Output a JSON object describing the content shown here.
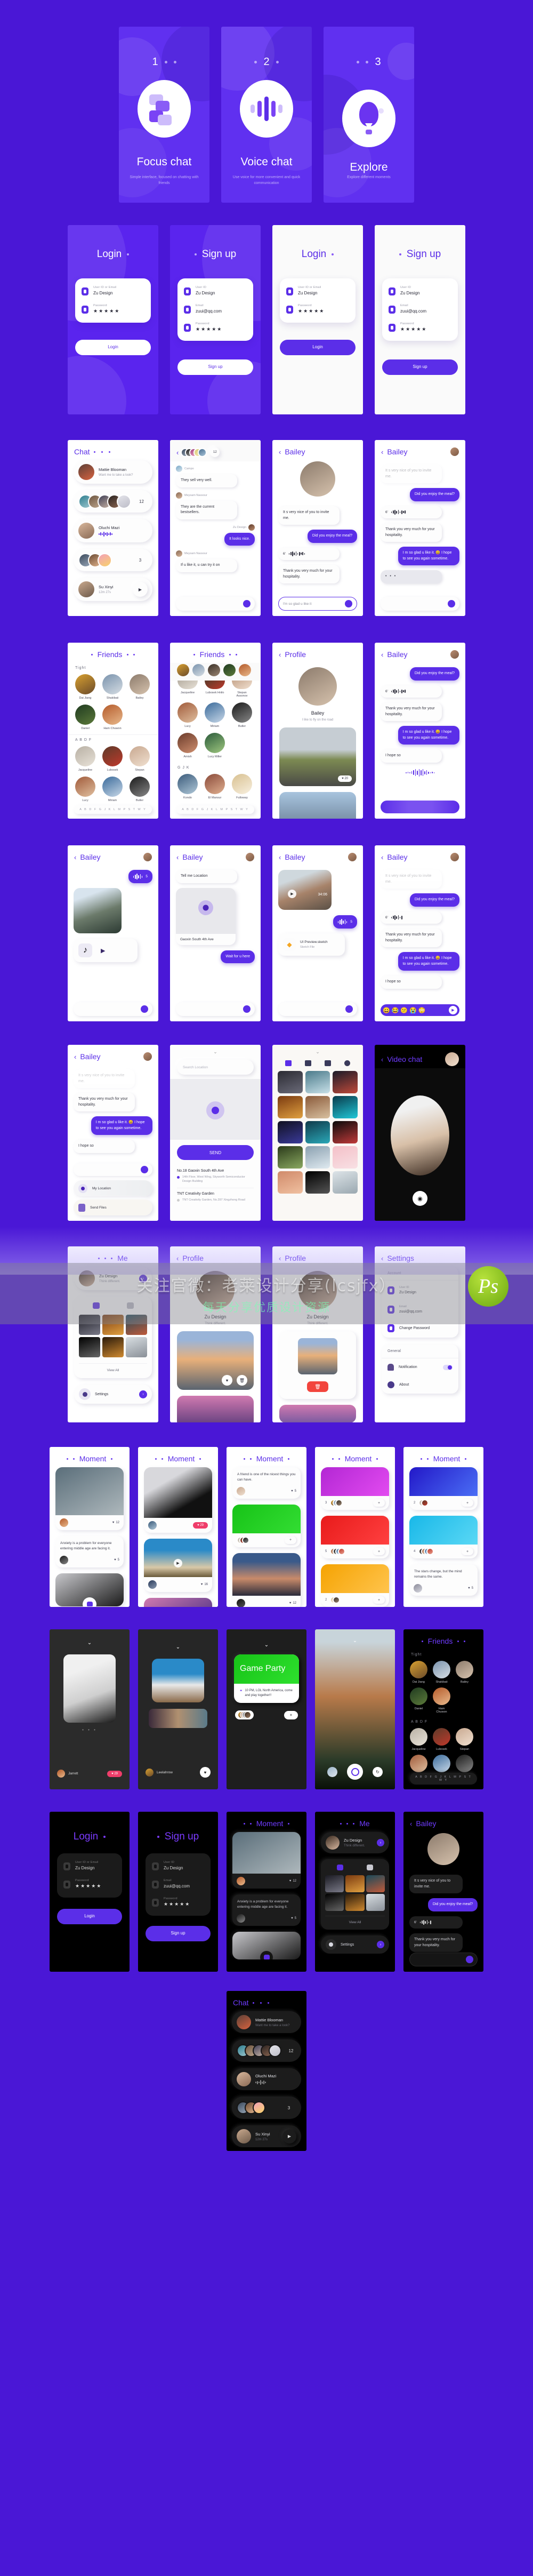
{
  "meta": {
    "brand_purple": "#5b2ee8",
    "bg_purple": "#4a17d6",
    "accent": "#6030f0"
  },
  "watermark": {
    "line1": "关注官微：老莱设计分享(lcsjfx）",
    "line2": "每天分享优质设计资源",
    "logo": "Ps"
  },
  "onboarding": [
    {
      "step": "1",
      "title": "Focus chat",
      "subtitle": "Simple interface, focused on chatting with friends",
      "icon": "chat-bubbles-icon"
    },
    {
      "step": "2",
      "title": "Voice chat",
      "subtitle": "Use voice for more convenient and quick communication",
      "icon": "voice-wave-icon"
    },
    {
      "step": "3",
      "title": "Explore",
      "subtitle": "Explore different moments",
      "icon": "hot-air-balloon-icon"
    }
  ],
  "auth": {
    "login_title": "Login",
    "signup_title": "Sign up",
    "login_button": "Login",
    "signup_button": "Sign up",
    "fields": {
      "userid_or_email_label": "User ID or Email",
      "userid_label": "User ID",
      "email_label": "Email",
      "password_label": "Password",
      "userid_value": "Zu Design",
      "email_value": "zuui@qq.com",
      "password_value": "★★★★★"
    }
  },
  "chat_list": {
    "title": "Chat",
    "rows": [
      {
        "name": "Mattie Blooman",
        "sub": "Want me to take a look?",
        "badge": ""
      },
      {
        "name": "",
        "sub": "",
        "badge": "12",
        "group": true
      },
      {
        "name": "Oluchi Mazi",
        "sub": "voice-waveform",
        "badge": ""
      },
      {
        "name": "",
        "sub": "",
        "badge": "3",
        "group": true
      },
      {
        "name": "Su Xinyi",
        "sub": "12m 27s",
        "badge": "video-call-icon"
      }
    ]
  },
  "group_chat": {
    "counter": "12",
    "messages": [
      {
        "author": "Campo",
        "text": "They sell very well.",
        "side": "in"
      },
      {
        "author": "Meysam Nassour",
        "text": "They are the current bestsellers.",
        "side": "in"
      },
      {
        "author": "Zu Design",
        "text": "It looks nice.",
        "side": "out"
      },
      {
        "author": "Meysam Nassour",
        "text": "If u like it, u can try it on",
        "side": "in"
      }
    ]
  },
  "bailey_chat": {
    "title": "Bailey",
    "messages": [
      {
        "text": "It s very nice of you to invite me.",
        "side": "in"
      },
      {
        "text": "Did you enjoy the meal?",
        "side": "out"
      },
      {
        "text": "6'",
        "side": "in",
        "type": "voice"
      },
      {
        "text": "Thank you very much for your hospitality.",
        "side": "in"
      },
      {
        "text": "I m so glad u like it. 😀 I hope to see you again sometime.",
        "side": "out"
      },
      {
        "text": "I hope so",
        "side": "in"
      }
    ],
    "draft": "I'm so glad u like it",
    "typing": "• • •",
    "voice_len": "5",
    "location_prompt": "Tell me Location",
    "location_name": "Gaoxin South 4th Ave",
    "location_reply": "Wait for u here",
    "video_time": "34:06",
    "file_name": "UI Preview.sketch",
    "file_type": "Sketch File",
    "quick_location": "My Location",
    "quick_files": "Send Files"
  },
  "friends": {
    "title": "Friends",
    "sections": [
      {
        "label": "Tight",
        "people": [
          "Dai Jiang",
          "Shakibaii",
          "Bailey",
          "Daniel",
          "Ham Chuwon"
        ]
      },
      {
        "label": "A B D F",
        "people": [
          "Jacqueline",
          "Lubosek",
          "Stepan",
          "Lucy",
          "Miriam",
          "Butler"
        ]
      },
      {
        "label": "G J K",
        "people": [
          "Kondo",
          "El Mansur",
          "Fulloway"
        ]
      }
    ],
    "scroller_top": [
      "Jacqueline",
      "Lubosek Hnilo",
      "Stepan Assonov"
    ],
    "scroller_rows": [
      [
        "Lucy",
        "Miriam",
        "Butler"
      ],
      [
        "Amish",
        "Lucy Miller"
      ]
    ],
    "alpha": "A B D F G J K L M P S T W Y"
  },
  "profile": {
    "title": "Profile",
    "name": "Bailey",
    "bio": "I like to fly on the road",
    "likes": "20"
  },
  "me": {
    "title": "Me",
    "name": "Zu Design",
    "bio": "Think different.",
    "view_all": "View All",
    "settings": "Settings"
  },
  "search_location": {
    "placeholder": "Search Location",
    "send_button": "SEND",
    "results": [
      {
        "title": "No.18 Gaoxin South 4th Ave",
        "sub": "14th Floor, West Wing, Skyworth Semiconductor Design Building"
      },
      {
        "title": "TNT Creativity Garden",
        "sub": "TNT Creativity Garden, No.397 Xingzhong Road"
      }
    ]
  },
  "video_chat": {
    "title": "Video chat"
  },
  "settings": {
    "title": "Settings",
    "groups": [
      {
        "label": "Account",
        "rows": [
          {
            "label": "User ID",
            "value": "Zu Design",
            "icon": "user-icon"
          },
          {
            "label": "Email",
            "value": "zuui@qq.com",
            "icon": "mail-icon"
          },
          {
            "label": "Change Password",
            "value": "",
            "icon": "lock-icon"
          }
        ]
      },
      {
        "label": "General",
        "rows": [
          {
            "label": "Notification",
            "value": "on",
            "icon": "bell-icon"
          },
          {
            "label": "About",
            "value": "",
            "icon": "info-icon"
          }
        ]
      }
    ]
  },
  "moment": {
    "title": "Moment",
    "posts": [
      {
        "text": "",
        "likes": "12",
        "type": "photo"
      },
      {
        "text": "Anxiety is a problem for everyone entering middle age are facing it.",
        "likes": "5",
        "type": "text"
      },
      {
        "text": "",
        "likes": "29",
        "type": "photo"
      },
      {
        "text": "",
        "likes": "16",
        "type": "video"
      },
      {
        "text": "A friend is one of the nicest things you can have.",
        "likes": "5",
        "type": "text"
      },
      {
        "text": "",
        "likes": "12",
        "type": "photo"
      },
      {
        "text": "The stars change, but the mind remains the same.",
        "likes": "5",
        "type": "text"
      }
    ],
    "group_counts": [
      "4",
      "3",
      "5",
      "2",
      "2",
      "4"
    ]
  },
  "story": {
    "author1": "Jarrett",
    "likes1": "29",
    "author2": "Leelahrow",
    "game_title": "Game Party",
    "game_desc": "10 PM, LOL North America, come and play together!!",
    "game_count": "4"
  }
}
